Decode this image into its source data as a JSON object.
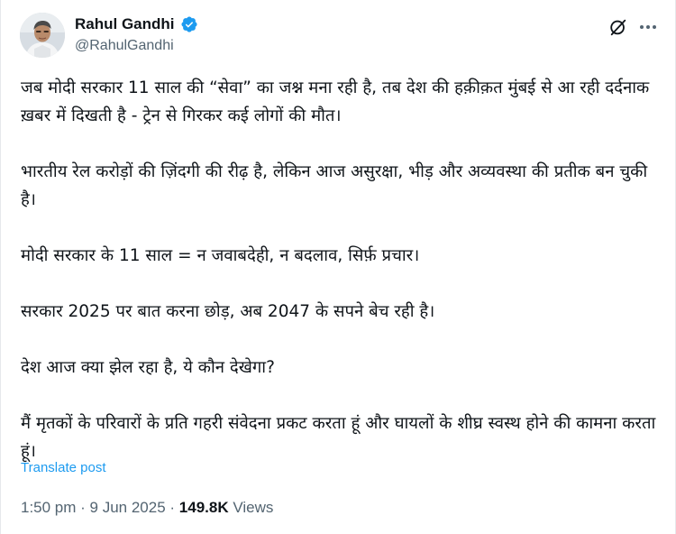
{
  "author": {
    "name": "Rahul Gandhi",
    "handle": "@RahulGandhi",
    "verified": true,
    "verified_color": "#1d9bf0"
  },
  "header_icons": [
    "grok-icon",
    "more-horizontal-icon"
  ],
  "tweet": {
    "paragraphs": [
      "जब मोदी सरकार 11 साल की “सेवा” का जश्न मना रही है, तब देश की हक़ीक़त मुंबई से आ रही दर्दनाक ख़बर में दिखती है - ट्रेन से गिरकर कई लोगों की मौत।",
      "भारतीय रेल करोड़ों की ज़िंदगी की रीढ़ है, लेकिन आज असुरक्षा, भीड़ और अव्यवस्था की प्रतीक बन चुकी है।",
      "मोदी सरकार के 11 साल = न जवाबदेही, न बदलाव, सिर्फ़ प्रचार।",
      "सरकार 2025 पर बात करना छोड़, अब 2047 के सपने बेच रही है।",
      "देश आज क्या झेल रहा है, ये कौन देखेगा?",
      "मैं मृतकों के परिवारों के प्रति गहरी संवेदना प्रकट करता हूं और घायलों के शीघ्र स्वस्थ होने की कामना करता हूं।"
    ]
  },
  "translate_label": "Translate post",
  "meta": {
    "time": "1:50 pm",
    "separator": " · ",
    "date": "9 Jun 2025",
    "views_count": "149.8K",
    "views_label": " Views"
  },
  "colors": {
    "text": "#0f1419",
    "secondary": "#536471",
    "link": "#1d9bf0"
  }
}
